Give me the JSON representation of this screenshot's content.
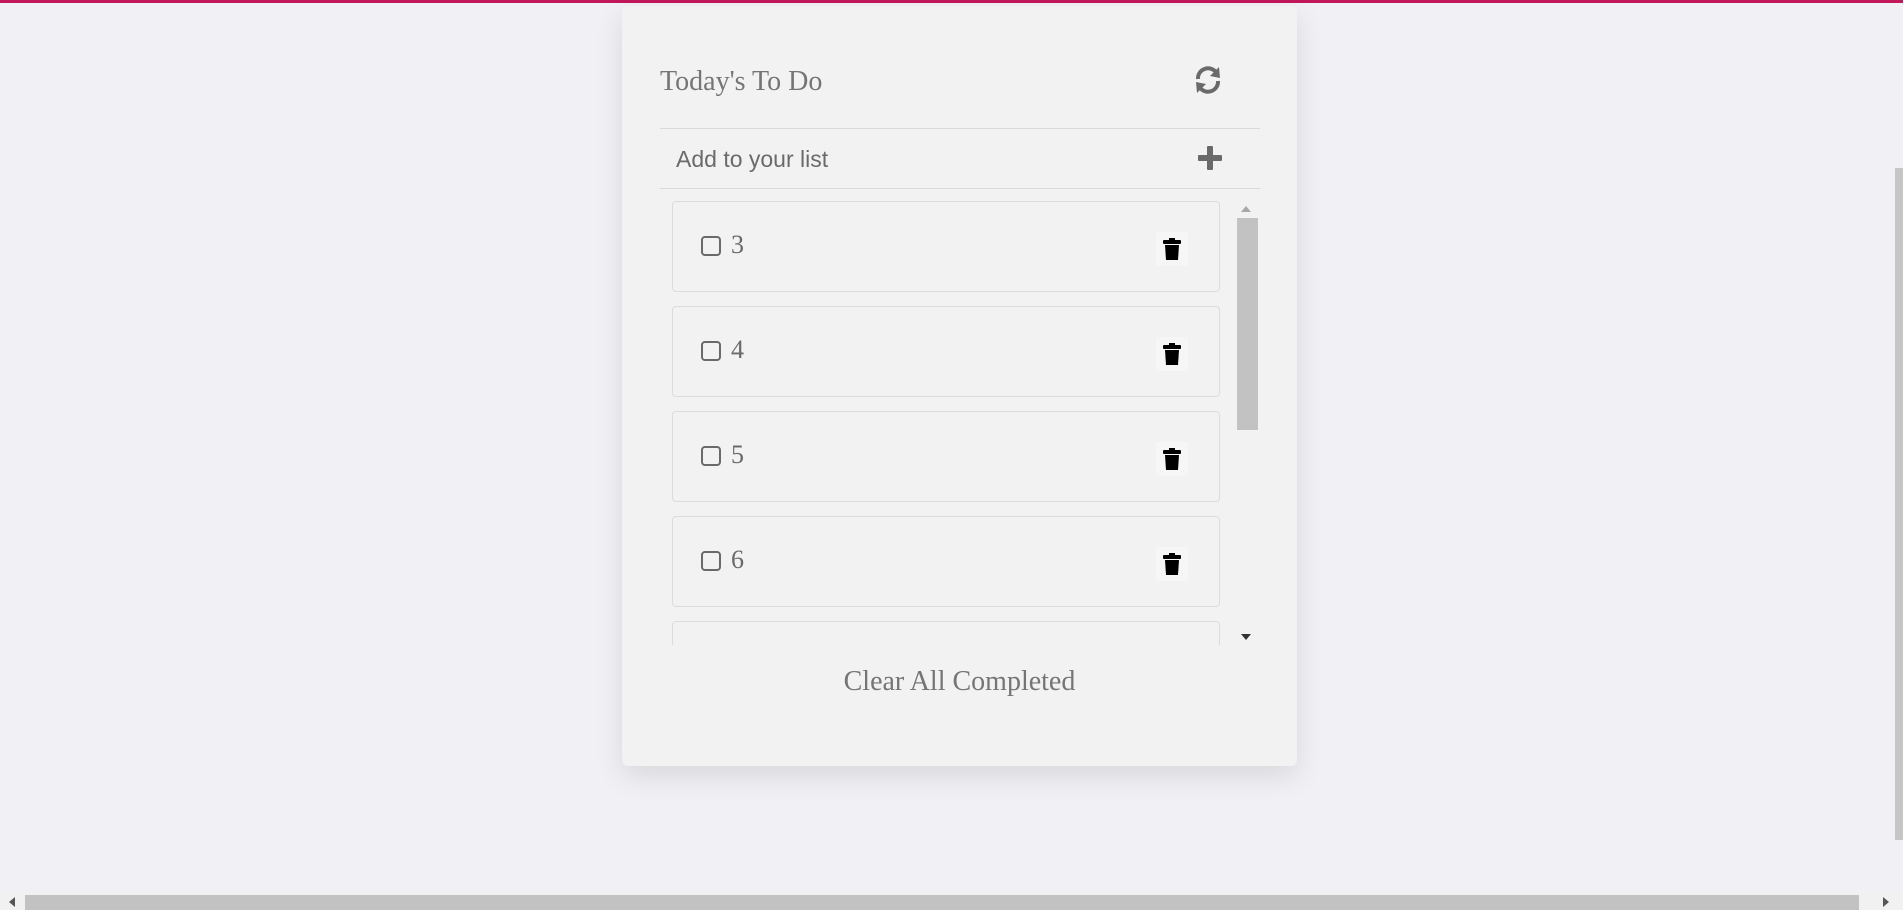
{
  "app": {
    "title": "Today's To Do",
    "icons": {
      "refresh": "refresh-icon",
      "add": "plus-icon",
      "delete": "trash-icon"
    },
    "accent_color": "#c2185b"
  },
  "add_row": {
    "placeholder": "Add to your list",
    "value": ""
  },
  "todos": [
    {
      "text": "3",
      "checked": false
    },
    {
      "text": "4",
      "checked": false
    },
    {
      "text": "5",
      "checked": false
    },
    {
      "text": "6",
      "checked": false
    },
    {
      "text": "",
      "checked": false
    }
  ],
  "footer": {
    "clear_label": "Clear All Completed"
  }
}
